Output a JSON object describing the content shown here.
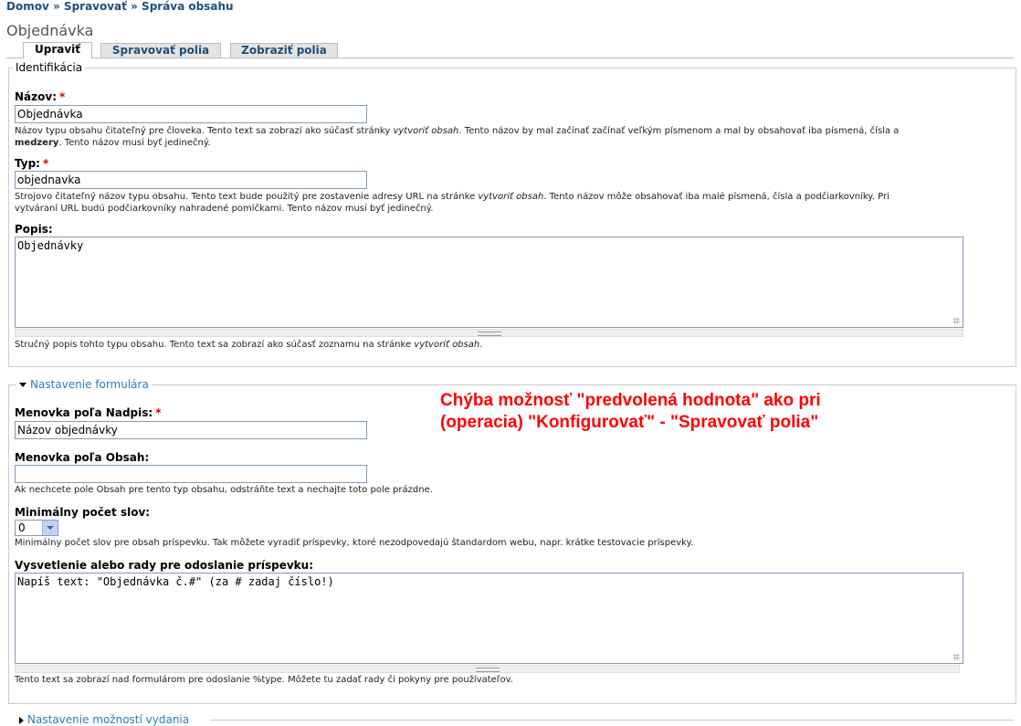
{
  "breadcrumb": {
    "items": [
      "Domov",
      "Spravovať",
      "Správa obsahu"
    ],
    "separator": "»"
  },
  "page_title": "Objednávka",
  "tabs": [
    {
      "label": "Upraviť",
      "active": true
    },
    {
      "label": "Spravovať polia",
      "active": false
    },
    {
      "label": "Zobraziť polia",
      "active": false
    }
  ],
  "identification": {
    "legend": "Identifikácia",
    "name_label": "Názov:",
    "name_value": "Objednávka",
    "name_desc_1": "Názov typu obsahu čitateľný pre človeka. Tento text sa zobrazí ako súčasť stránky ",
    "name_desc_em": "vytvoriť obsah",
    "name_desc_2": ". Tento názov by mal začínať začínať veľkým písmenom a mal by obsahovať iba písmená, čísla a",
    "name_desc_strong": "medzery",
    "name_desc_3": ". Tento názov musí byť jedinečný.",
    "type_label": "Typ:",
    "type_value": "objednavka",
    "type_desc_1": "Strojovo čitateľný názov typu obsahu. Tento text bude použitý pre zostavenie adresy URL na stránke ",
    "type_desc_em": "vytvoriť obsah",
    "type_desc_2": ". Tento názov môže obsahovať iba malé písmená, čísla a podčiarkovníky. Pri",
    "type_desc_3": "vytváraní URL budú podčiarkovníky nahradené pomlčkami. Tento názov musí byť jedinečný.",
    "desc_label": "Popis:",
    "desc_value": "Objednávky",
    "desc_desc_1": "Stručný popis tohto typu obsahu. Tento text sa zobrazí ako súčasť zoznamu na stránke ",
    "desc_desc_em": "vytvoriť obsah",
    "desc_desc_2": "."
  },
  "form_settings": {
    "legend": "Nastavenie formulára",
    "title_label": "Menovka poľa Nadpis:",
    "title_value": "Názov objednávky",
    "body_label": "Menovka poľa Obsah:",
    "body_value": "",
    "body_desc": "Ak nechcete pole Obsah pre tento typ obsahu, odstráňte text a nechajte toto pole prázdne.",
    "min_words_label": "Minimálny počet slov:",
    "min_words_value": "0",
    "min_words_desc": "Minimálny počet slov pre obsah príspevku. Tak môžete vyradiť príspevky, ktoré nezodpovedajú štandardom webu, napr. krátke testovacie príspevky.",
    "help_label": "Vysvetlenie alebo rady pre odoslanie príspevku:",
    "help_value": "Napíš text: \"Objednávka č.#\" (za # zadaj číslo!)",
    "help_desc": "Tento text sa zobrazí nad formulárom pre odoslanie %type. Môžete tu zadať rady či pokyny pre používateľov."
  },
  "annotation": {
    "line1": "Chýba možnosť \"predvolená hodnota\" ako pri",
    "line2": "(operacia) \"Konfigurovať\" - \"Spravovať polia\""
  },
  "publishing": {
    "legend": "Nastavenie možností vydania"
  },
  "required_marker": "*"
}
